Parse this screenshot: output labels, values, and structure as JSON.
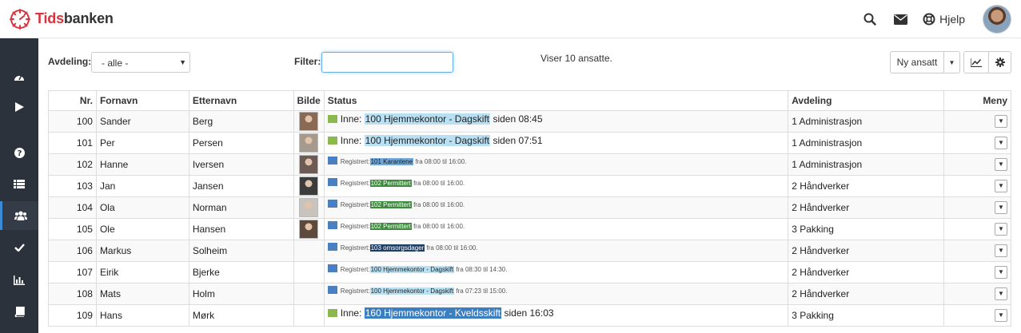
{
  "brand": {
    "name_red": "Tids",
    "name_rest": "banken"
  },
  "header": {
    "help_label": "Hjelp"
  },
  "toolbar": {
    "department_label": "Avdeling:",
    "department_value": "- alle -",
    "filter_label": "Filter:",
    "filter_value": "",
    "showing_text": "Viser 10 ansatte.",
    "new_employee_label": "Ny ansatt"
  },
  "table": {
    "headers": {
      "nr": "Nr.",
      "firstname": "Fornavn",
      "lastname": "Etternavn",
      "photo": "Bilde",
      "status": "Status",
      "department": "Avdeling",
      "menu": "Meny"
    },
    "rows": [
      {
        "nr": "100",
        "first": "Sander",
        "last": "Berg",
        "dept": "1 Administrasjon",
        "photo": "#8a6a52",
        "status": {
          "kind": "in",
          "prefix": "Inne:",
          "code": "100 Hjemmekontor - Dagskift",
          "suffix": "siden 08:45"
        }
      },
      {
        "nr": "101",
        "first": "Per",
        "last": "Persen",
        "dept": "1 Administrasjon",
        "photo": "#a59a8c",
        "status": {
          "kind": "in",
          "prefix": "Inne:",
          "code": "100 Hjemmekontor - Dagskift",
          "suffix": "siden 07:51"
        }
      },
      {
        "nr": "102",
        "first": "Hanne",
        "last": "Iversen",
        "dept": "1 Administrasjon",
        "photo": "#6e5a55",
        "status": {
          "kind": "reg",
          "prefix": "Registrert:",
          "code": "101 Karantene",
          "suffix": "fra 08:00 til 16:00."
        }
      },
      {
        "nr": "103",
        "first": "Jan",
        "last": "Jansen",
        "dept": "2 Håndverker",
        "photo": "#3c3c3c",
        "status": {
          "kind": "reg",
          "prefix": "Registrert:",
          "code": "102 Permittert",
          "suffix": "fra 08:00 til 16:00."
        }
      },
      {
        "nr": "104",
        "first": "Ola",
        "last": "Norman",
        "dept": "2 Håndverker",
        "photo": "#c9c3bd",
        "status": {
          "kind": "reg",
          "prefix": "Registrert:",
          "code": "102 Permittert",
          "suffix": "fra 08:00 til 16:00."
        }
      },
      {
        "nr": "105",
        "first": "Ole",
        "last": "Hansen",
        "dept": "3 Pakking",
        "photo": "#5e4a3c",
        "status": {
          "kind": "reg",
          "prefix": "Registrert:",
          "code": "102 Permittert",
          "suffix": "fra 08:00 til 16:00."
        }
      },
      {
        "nr": "106",
        "first": "Markus",
        "last": "Solheim",
        "dept": "2 Håndverker",
        "photo": "",
        "status": {
          "kind": "reg",
          "prefix": "Registrert:",
          "code": "103 omsorgsdager",
          "suffix": "fra 08:00 til 16:00."
        }
      },
      {
        "nr": "107",
        "first": "Eirik",
        "last": "Bjerke",
        "dept": "2 Håndverker",
        "photo": "",
        "status": {
          "kind": "reg",
          "prefix": "Registrert:",
          "code": "100 Hjemmekontor - Dagskift",
          "suffix": "fra 08:30 til 14:30."
        }
      },
      {
        "nr": "108",
        "first": "Mats",
        "last": "Holm",
        "dept": "2 Håndverker",
        "photo": "",
        "status": {
          "kind": "reg",
          "prefix": "Registrert:",
          "code": "100 Hjemmekontor - Dagskift",
          "suffix": "fra 07:23 til 15:00."
        }
      },
      {
        "nr": "109",
        "first": "Hans",
        "last": "Mørk",
        "dept": "3 Pakking",
        "photo": "",
        "status": {
          "kind": "in",
          "prefix": "Inne:",
          "code": "160 Hjemmekontor - Kveldsskift",
          "suffix": "siden 16:03"
        }
      }
    ]
  },
  "code_colors": {
    "100 Hjemmekontor - Dagskift": {
      "bg": "#b9e0f2",
      "fg": "#222222"
    },
    "101 Karantene": {
      "bg": "#6fa8dc",
      "fg": "#1a1a1a"
    },
    "102 Permittert": {
      "bg": "#3f8a3f",
      "fg": "#ffffff"
    },
    "103 omsorgsdager": {
      "bg": "#1f3f66",
      "fg": "#ffffff"
    },
    "160 Hjemmekontor - Kveldsskift": {
      "bg": "#3c7fc0",
      "fg": "#ffffff"
    }
  }
}
